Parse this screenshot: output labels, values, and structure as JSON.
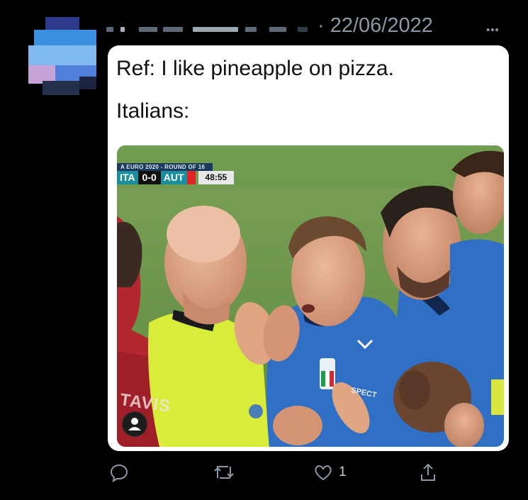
{
  "tweet": {
    "date": "· 22/06/2022",
    "more_label": "•••",
    "text_line1": "Ref: I like pineapple on pizza.",
    "text_line2": "Italians:"
  },
  "scorebug": {
    "competition": "A EURO 2020 - ROUND OF 16",
    "home": "ITA",
    "score": "0-0",
    "away": "AUT",
    "clock": "48:55"
  },
  "photo_overlays": {
    "back_name": "TAVIS",
    "sponsor": "SPECT"
  },
  "actions": {
    "reply_icon": "reply-icon",
    "retweet_icon": "retweet-icon",
    "like_icon": "heart-icon",
    "like_count": "1",
    "share_icon": "share-icon"
  },
  "colors": {
    "background": "#000000",
    "card": "#ffffff",
    "muted": "#8b98a5",
    "pitch": "#6f9a4e",
    "italy_blue": "#2f6fc4",
    "ref_yellow": "#d8ec3a",
    "austria_red": "#b3282f"
  }
}
